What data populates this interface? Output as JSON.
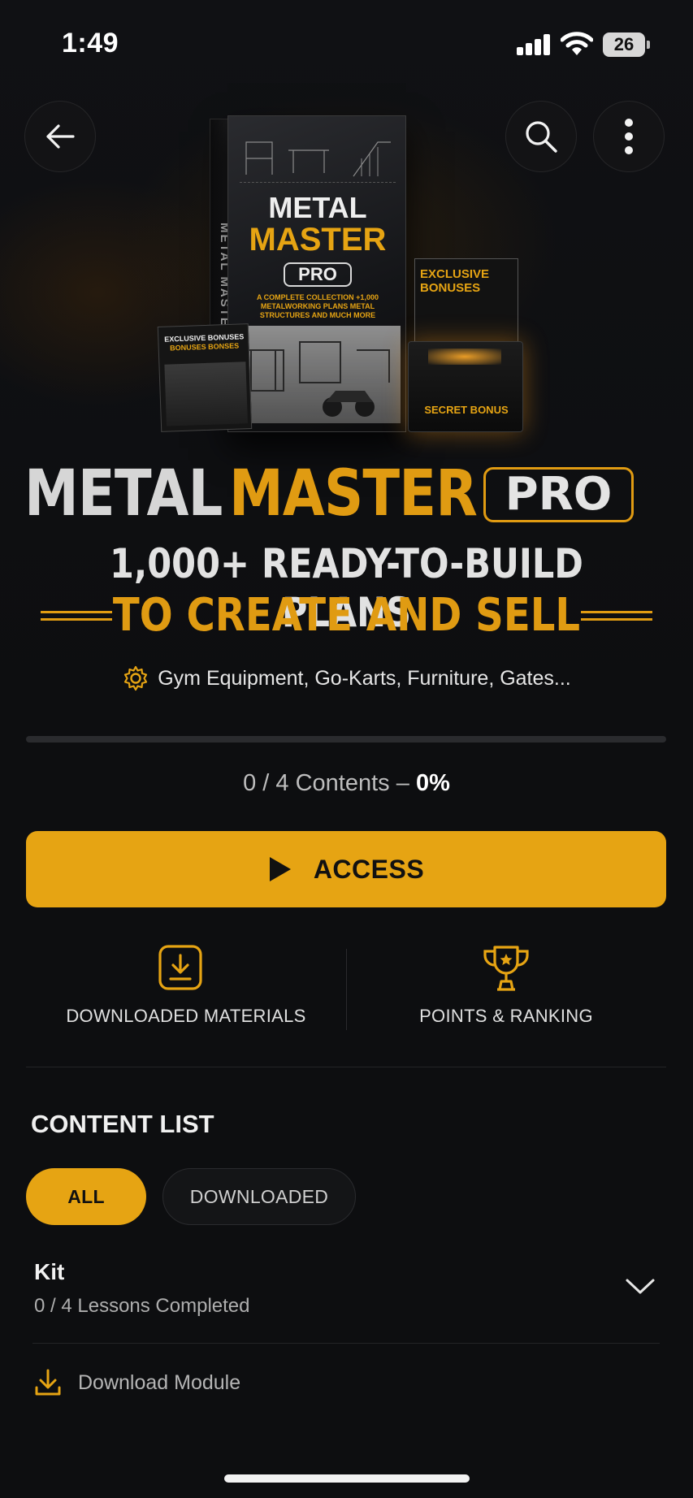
{
  "status_bar": {
    "time": "1:49",
    "battery": "26"
  },
  "header": {
    "back_icon": "arrow-left-icon",
    "search_icon": "search-icon",
    "more_icon": "more-vertical-icon"
  },
  "product_art": {
    "spine": "METAL MASTER PRO",
    "box_title_1": "METAL",
    "box_title_2": "MASTER",
    "box_pro": "PRO",
    "box_sub": "A COMPLETE COLLECTION +1,000 METALWORKING PLANS METAL STRUCTURES AND MUCH MORE",
    "card_left_title_1": "EXCLUSIVE BONUSES",
    "card_left_title_2": "BONUSES BONSES",
    "card_right_title": "EXCLUSIVE BONUSES",
    "chest_label": "SECRET BONUS"
  },
  "headline": {
    "word1": "METAL",
    "word2": "MASTER",
    "badge": "PRO",
    "line2": "1,000+ READY-TO-BUILD PLANS",
    "line3": "TO CREATE AND SELL",
    "tagline": "Gym Equipment, Go-Karts, Furniture, Gates..."
  },
  "progress": {
    "label": "0 / 4 Contents – ",
    "percent_text": "0%",
    "value": 0
  },
  "access_button": {
    "label": "ACCESS"
  },
  "quick_actions": [
    {
      "label": "DOWNLOADED MATERIALS",
      "icon": "download-box-icon"
    },
    {
      "label": "POINTS & RANKING",
      "icon": "trophy-icon"
    }
  ],
  "content_list": {
    "title": "CONTENT LIST",
    "filters": [
      "ALL",
      "DOWNLOADED"
    ],
    "active_filter": "ALL",
    "modules": [
      {
        "title": "Kit",
        "subtitle": "0 / 4 Lessons Completed",
        "download_label": "Download Module"
      }
    ]
  },
  "colors": {
    "accent": "#E6A413",
    "background": "#0D0E10"
  }
}
